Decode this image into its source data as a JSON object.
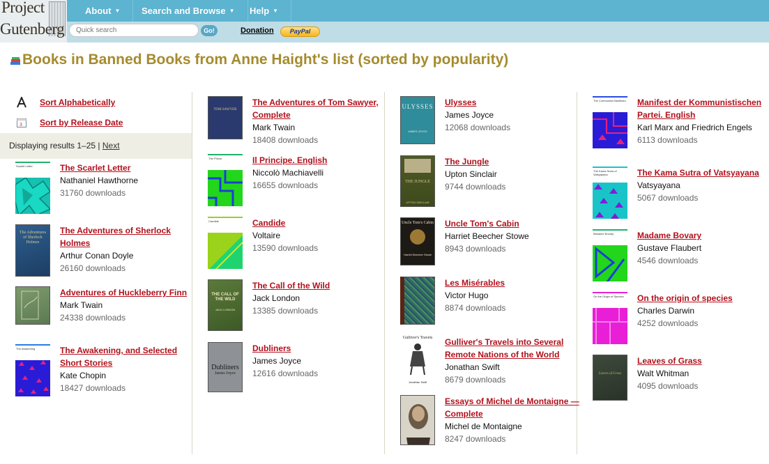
{
  "header": {
    "logo_line1": "Project",
    "logo_line2": "Gutenberg",
    "menu": [
      "About",
      "Search and Browse",
      "Help"
    ],
    "search_placeholder": "Quick search",
    "go_label": "Go!",
    "donation_label": "Donation",
    "paypal_label": "PayPal"
  },
  "page": {
    "title": "Books in Banned Books from Anne Haight's list (sorted by popularity)"
  },
  "sort": {
    "alpha": "Sort Alphabetically",
    "release": "Sort by Release Date"
  },
  "results": {
    "text": "Displaying results 1–25 |",
    "next": "Next"
  },
  "books": [
    {
      "title": "The Scarlet Letter",
      "author": "Nathaniel Hawthorne",
      "downloads": "31760 downloads"
    },
    {
      "title": "The Adventures of Sherlock Holmes",
      "author": "Arthur Conan Doyle",
      "downloads": "26160 downloads"
    },
    {
      "title": "Adventures of Huckleberry Finn",
      "author": "Mark Twain",
      "downloads": "24338 downloads"
    },
    {
      "title": "The Awakening, and Selected Short Stories",
      "author": "Kate Chopin",
      "downloads": "18427 downloads"
    },
    {
      "title": "The Adventures of Tom Sawyer, Complete",
      "author": "Mark Twain",
      "downloads": "18408 downloads"
    },
    {
      "title": "Il Principe. English",
      "author": "Niccolò Machiavelli",
      "downloads": "16655 downloads"
    },
    {
      "title": "Candide",
      "author": "Voltaire",
      "downloads": "13590 downloads"
    },
    {
      "title": "The Call of the Wild",
      "author": "Jack London",
      "downloads": "13385 downloads"
    },
    {
      "title": "Dubliners",
      "author": "James Joyce",
      "downloads": "12616 downloads"
    },
    {
      "title": "Ulysses",
      "author": "James Joyce",
      "downloads": "12068 downloads"
    },
    {
      "title": "The Jungle",
      "author": "Upton Sinclair",
      "downloads": "9744 downloads"
    },
    {
      "title": "Uncle Tom's Cabin",
      "author": "Harriet Beecher Stowe",
      "downloads": "8943 downloads"
    },
    {
      "title": "Les Misérables",
      "author": "Victor Hugo",
      "downloads": "8874 downloads"
    },
    {
      "title": "Gulliver's Travels into Several Remote Nations of the World",
      "author": "Jonathan Swift",
      "downloads": "8679 downloads"
    },
    {
      "title": "Essays of Michel de Montaigne — Complete",
      "author": "Michel de Montaigne",
      "downloads": "8247 downloads"
    },
    {
      "title": "Manifest der Kommunistischen Partei. English",
      "author": "Karl Marx and Friedrich Engels",
      "downloads": "6113 downloads"
    },
    {
      "title": "The Kama Sutra of Vatsyayana",
      "author": "Vatsyayana",
      "downloads": "5067 downloads"
    },
    {
      "title": "Madame Bovary",
      "author": "Gustave Flaubert",
      "downloads": "4546 downloads"
    },
    {
      "title": "On the origin of species",
      "author": "Charles Darwin",
      "downloads": "4252 downloads"
    },
    {
      "title": "Leaves of Grass",
      "author": "Walt Whitman",
      "downloads": "4095 downloads"
    }
  ],
  "covers": {
    "ulysses_text": "ULYSSES",
    "ulysses_author": "JAMES JOYCE",
    "jungle_text": "THE JUNGLE",
    "jungle_author": "UPTON SINCLAIR",
    "uncle_tom_text": "Uncle Tom's Cabin",
    "uncle_tom_author": "Harriet Beecher Stowe",
    "dubliners_text": "Dubliners",
    "dubliners_author": "James Joyce",
    "gulliver_text": "Gulliver's Travels",
    "gulliver_author": "Jonathan Swift",
    "call_wild_text": "THE CALL OF THE WILD",
    "call_wild_author": "JACK LONDON",
    "sherlock_text": "The Adventures of Sherlock Holmes",
    "tom_sawyer_text": "TOM SAWYER",
    "leaves_text": "Leaves of Grass"
  },
  "colors": {
    "link": "#b0111c",
    "title": "#a58b2d",
    "header_top": "#5db4d0",
    "header_bottom": "#bfdde6"
  }
}
